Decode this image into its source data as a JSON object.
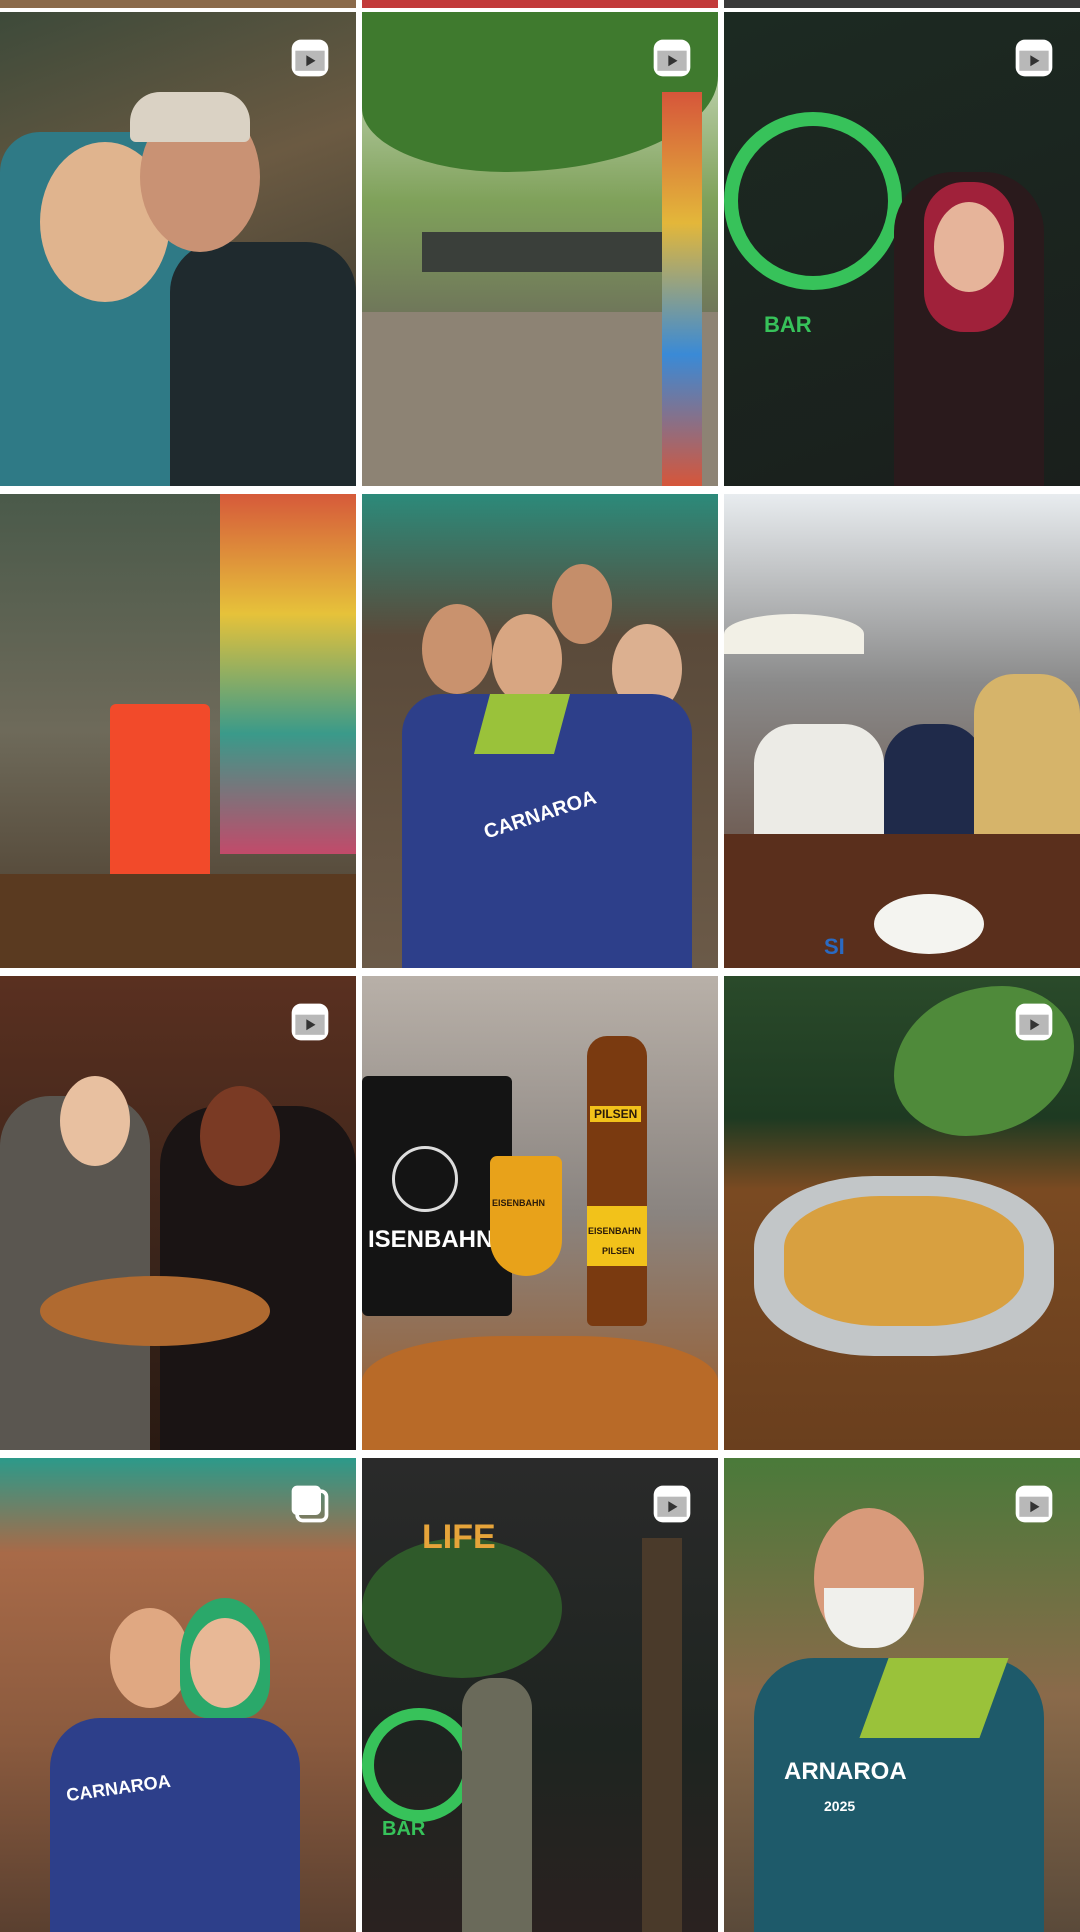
{
  "grid": {
    "tiles": [
      {
        "id": "t1",
        "badge": "reels-icon"
      },
      {
        "id": "t2",
        "badge": "reels-icon"
      },
      {
        "id": "t3",
        "badge": "reels-icon",
        "text": "BAR"
      },
      {
        "id": "t4",
        "badge": ""
      },
      {
        "id": "t5",
        "badge": "",
        "text": "CARNAROA"
      },
      {
        "id": "t6",
        "badge": "",
        "text": "SI"
      },
      {
        "id": "t7",
        "badge": "reels-icon"
      },
      {
        "id": "t8",
        "badge": "",
        "text_bucket": "ISENBAHN",
        "text_glass": "EISENBAHN",
        "text_bottle_top": "PILSEN",
        "text_bottle": "EISENBAHN",
        "text_bottle_sub": "PILSEN"
      },
      {
        "id": "t9",
        "badge": "reels-icon"
      },
      {
        "id": "t10",
        "badge": "carousel-icon",
        "text": "CARNAROA"
      },
      {
        "id": "t11",
        "badge": "reels-icon",
        "text_life": "LIFE",
        "text_bar": "BAR"
      },
      {
        "id": "t12",
        "badge": "reels-icon",
        "text": "ARNAROA",
        "text_year": "2025"
      }
    ]
  }
}
